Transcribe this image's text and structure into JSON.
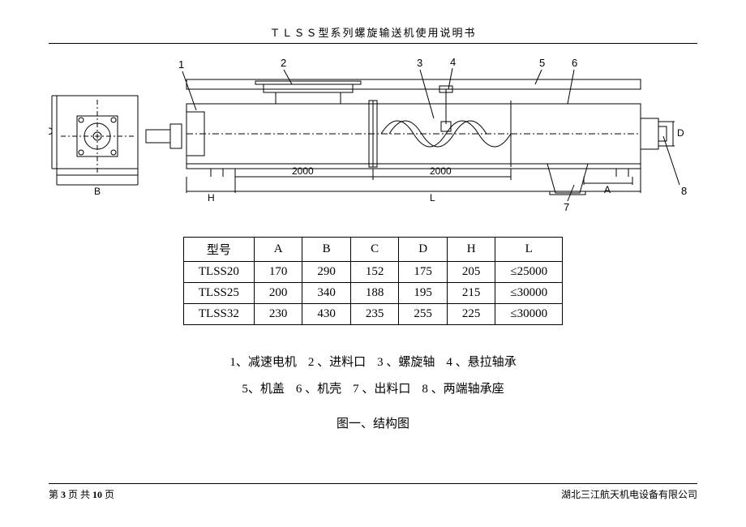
{
  "header": {
    "title": "ＴＬＳＳ型系列螺旋输送机使用说明书"
  },
  "drawing": {
    "dims": {
      "C": "C",
      "B": "B",
      "H": "H",
      "L": "L",
      "A": "A",
      "D": "D",
      "seg1": "2000",
      "seg2": "2000"
    },
    "callouts": {
      "c1": "1",
      "c2": "2",
      "c3": "3",
      "c4": "4",
      "c5": "5",
      "c6": "6",
      "c7": "7",
      "c8": "8"
    }
  },
  "table": {
    "headers": [
      "型号",
      "A",
      "B",
      "C",
      "D",
      "H",
      "L"
    ],
    "rows": [
      [
        "TLSS20",
        "170",
        "290",
        "152",
        "175",
        "205",
        "≤25000"
      ],
      [
        "TLSS25",
        "200",
        "340",
        "188",
        "195",
        "215",
        "≤30000"
      ],
      [
        "TLSS32",
        "230",
        "430",
        "235",
        "255",
        "225",
        "≤30000"
      ]
    ]
  },
  "legend": {
    "items": [
      {
        "n": "1、",
        "t": "减速电机"
      },
      {
        "n": "2  、",
        "t": "进料口"
      },
      {
        "n": "3  、",
        "t": "螺旋轴"
      },
      {
        "n": "4  、",
        "t": "悬拉轴承"
      },
      {
        "n": "5、",
        "t": "机盖"
      },
      {
        "n": "6    、",
        "t": "机壳"
      },
      {
        "n": "7    、",
        "t": "出料口"
      },
      {
        "n": "8  、",
        "t": "两端轴承座"
      }
    ],
    "caption": "图一、结构图"
  },
  "footer": {
    "left_a": "第",
    "left_b": "3",
    "left_c": " 页 共 ",
    "left_d": "10",
    "left_e": " 页",
    "right": "湖北三江航天机电设备有限公司"
  }
}
